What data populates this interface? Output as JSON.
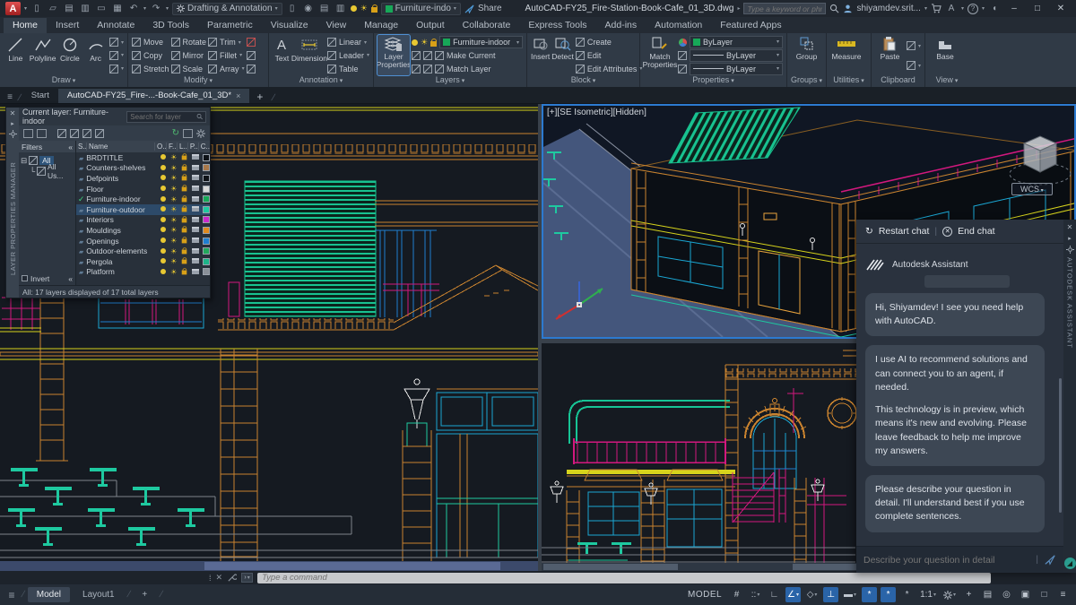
{
  "titlebar": {
    "app_button": "A",
    "workspace": "Drafting & Annotation",
    "layer_quick": "Furniture-indo",
    "share_label": "Share",
    "doc_title": "AutoCAD-FY25_Fire-Station-Book-Cafe_01_3D.dwg",
    "search_placeholder": "Type a keyword or phrase",
    "user_name": "shiyamdev.srit...",
    "autodesk_menu": "A",
    "help_menu": "?"
  },
  "ribbon": {
    "tabs": [
      {
        "label": "Home",
        "active": true
      },
      {
        "label": "Insert"
      },
      {
        "label": "Annotate"
      },
      {
        "label": "3D Tools"
      },
      {
        "label": "Parametric"
      },
      {
        "label": "Visualize"
      },
      {
        "label": "View"
      },
      {
        "label": "Manage"
      },
      {
        "label": "Output"
      },
      {
        "label": "Collaborate"
      },
      {
        "label": "Express Tools"
      },
      {
        "label": "Add-ins"
      },
      {
        "label": "Automation"
      },
      {
        "label": "Featured Apps"
      }
    ],
    "panels": {
      "draw": {
        "label": "Draw",
        "line": "Line",
        "polyline": "Polyline",
        "circle": "Circle",
        "arc": "Arc"
      },
      "modify": {
        "label": "Modify",
        "tools": [
          "Move",
          "Copy",
          "Stretch",
          "Rotate",
          "Mirror",
          "Scale",
          "Trim",
          "Fillet",
          "Array"
        ]
      },
      "annotation": {
        "label": "Annotation",
        "text": "Text",
        "dimension": "Dimension",
        "tools": [
          "Linear",
          "Leader",
          "Table"
        ]
      },
      "layers": {
        "label": "Layers",
        "layer_properties": "Layer Properties",
        "current_layer": "Furniture-indoor",
        "make_current": "Make Current",
        "match_layer": "Match Layer"
      },
      "block": {
        "label": "Block",
        "insert": "Insert",
        "detect": "Detect",
        "tools": [
          "Create",
          "Edit",
          "Edit Attributes"
        ]
      },
      "properties": {
        "label": "Properties",
        "match_properties": "Match Properties",
        "bylayer1": "ByLayer",
        "bylayer2": "ByLayer",
        "bylayer3": "ByLayer"
      },
      "groups": {
        "label": "Groups",
        "group": "Group"
      },
      "utilities": {
        "label": "Utilities",
        "measure": "Measure"
      },
      "clipboard": {
        "label": "Clipboard",
        "paste": "Paste"
      },
      "view": {
        "label": "View",
        "base": "Base"
      }
    }
  },
  "file_tabs": {
    "start": "Start",
    "active_doc": "AutoCAD-FY25_Fire-...-Book-Cafe_01_3D*"
  },
  "layer_manager": {
    "vertical_title": "LAYER PROPERTIES MANAGER",
    "current_layer_label": "Current layer: Furniture-indoor",
    "search_placeholder": "Search for layer",
    "filters_label": "Filters",
    "tree_all": "All",
    "tree_all_used": "All Us...",
    "columns": [
      "S..",
      "Name",
      "O..",
      "F..",
      "L..",
      "P..",
      "C.."
    ],
    "rows": [
      {
        "name": "BRDTITLE",
        "color": "#0e1217"
      },
      {
        "name": "Counters-shelves",
        "color": "#a8784a"
      },
      {
        "name": "Defpoints",
        "color": "#0e1217"
      },
      {
        "name": "Floor",
        "color": "#d8d8d8"
      },
      {
        "name": "Furniture-indoor",
        "color": "#17a858",
        "current": true
      },
      {
        "name": "Furniture-outdoor",
        "color": "#1ec9a0",
        "selected": true
      },
      {
        "name": "Interiors",
        "color": "#cc29cc"
      },
      {
        "name": "Mouldings",
        "color": "#e08a1e"
      },
      {
        "name": "Openings",
        "color": "#1f7fd0"
      },
      {
        "name": "Outdoor-elements",
        "color": "#23a85c"
      },
      {
        "name": "Pergola",
        "color": "#1db488"
      },
      {
        "name": "Platform",
        "color": "#8a9098"
      }
    ],
    "invert_label": "Invert",
    "status_text": "All: 17 layers displayed of 17 total layers"
  },
  "viewport": {
    "iso_label": "[+][SE Isometric][Hidden]",
    "wcs": "WCS"
  },
  "assistant": {
    "restart_label": "Restart chat",
    "end_label": "End chat",
    "title": "Autodesk Assistant",
    "messages": [
      {
        "paragraphs": [
          "Hi, Shiyamdev! I see you need help with AutoCAD."
        ]
      },
      {
        "paragraphs": [
          "I use AI to recommend solutions and can connect you to an agent, if needed.",
          "This technology is in preview, which means it's new and evolving. Please leave feedback to help me improve my answers."
        ]
      },
      {
        "paragraphs": [
          "Please describe your question in detail. I'll understand best if you use complete sentences."
        ]
      }
    ],
    "input_placeholder": "Describe your question in detail",
    "vertical_label": "AUTODESK ASSISTANT"
  },
  "command_line": {
    "placeholder": "Type a command"
  },
  "status_bar": {
    "model_tab": "Model",
    "layout_tab": "Layout1",
    "model_indicator": "MODEL",
    "annotation_scale": "1:1"
  },
  "colors": {
    "accent_blue": "#2c7ad0",
    "layer_green": "#17a858",
    "layer_teal": "#1ec9a0",
    "cad_orange": "#c9832f",
    "cad_yellow": "#d6d31c",
    "cad_magenta": "#d2187e",
    "cad_cyan": "#1aa7d4"
  }
}
